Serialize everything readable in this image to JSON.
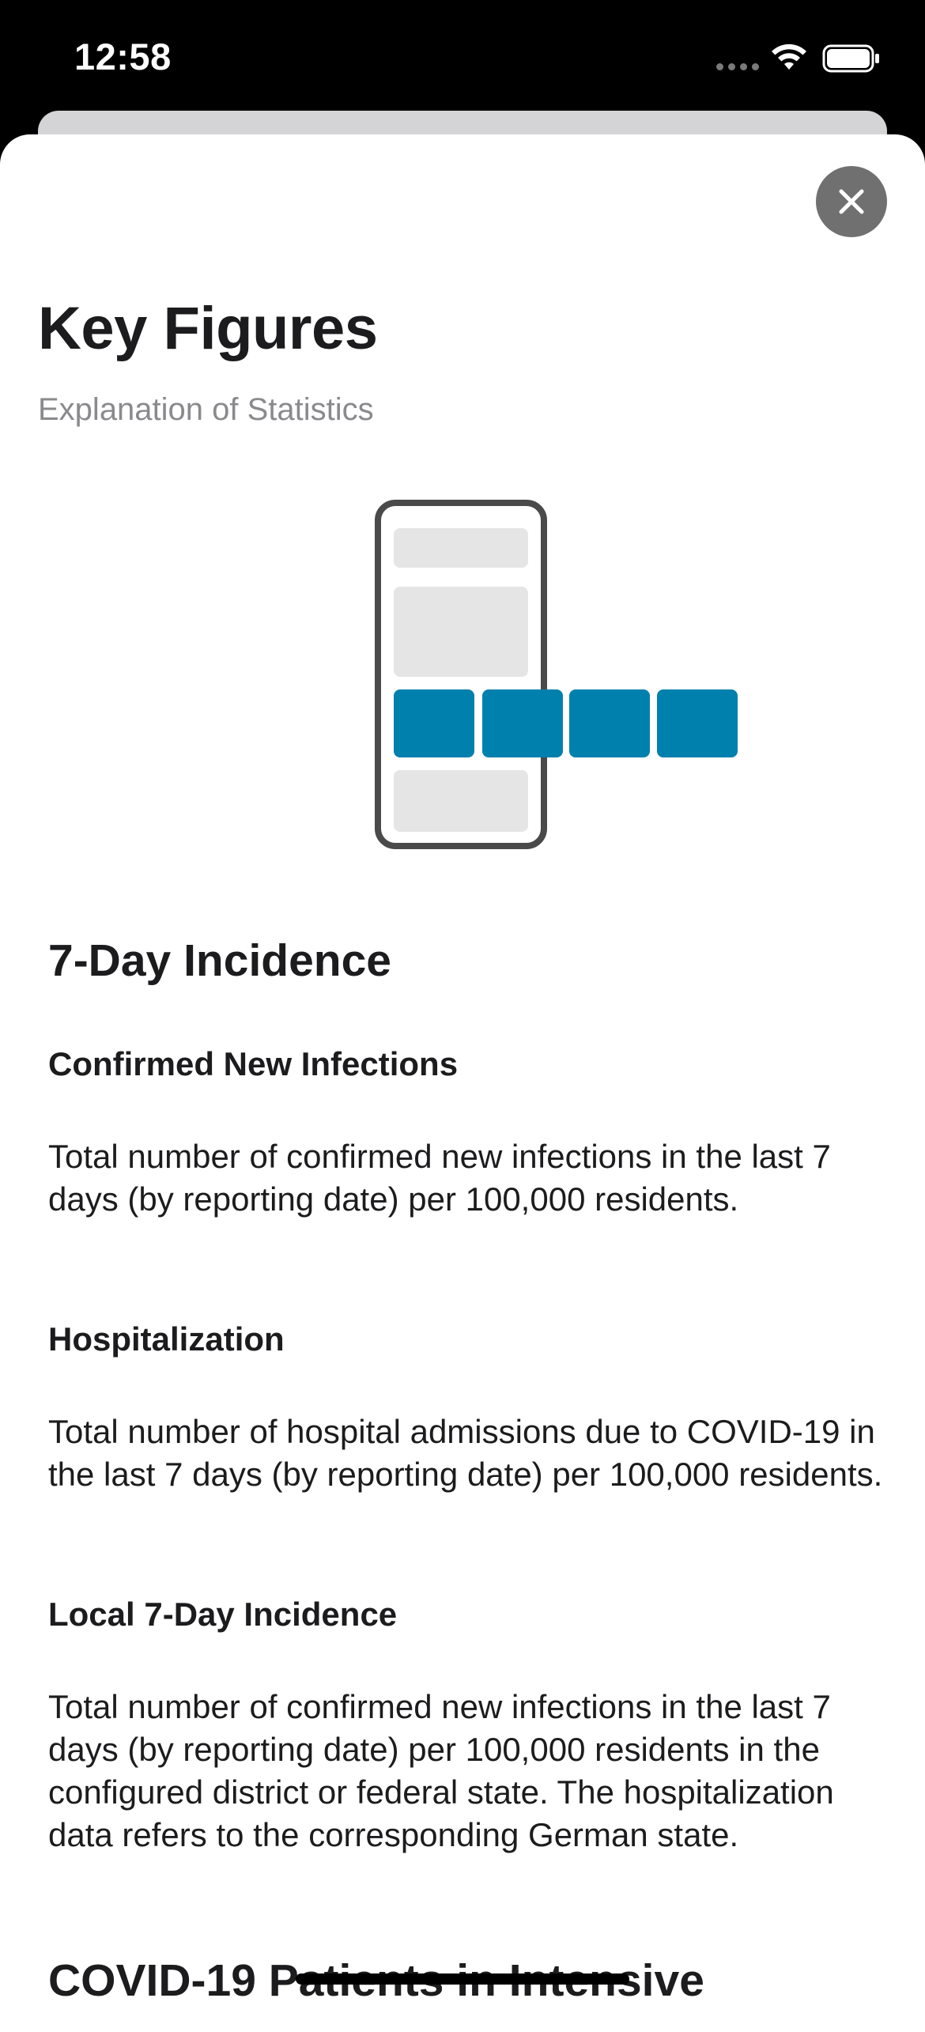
{
  "status_bar": {
    "time": "12:58",
    "icons": [
      "signal-icon",
      "wifi-icon",
      "battery-icon"
    ]
  },
  "header": {
    "title": "Key Figures",
    "subtitle": "Explanation of Statistics",
    "close_icon": "close-icon"
  },
  "illustration": {
    "icon": "phone-with-tiles-illustration",
    "colors": {
      "frame": "#4a4a4a",
      "placeholder": "#e5e5e5",
      "tile": "#0080ad"
    }
  },
  "sections": {
    "incidence": {
      "heading": "7-Day Incidence",
      "items": [
        {
          "title": "Confirmed New Infections",
          "text": "Total number of confirmed new infections in the last 7 days (by reporting date) per 100,000 residents."
        },
        {
          "title": "Hospitalization",
          "text": "Total number of hospital admissions due to COVID-19 in the last 7 days (by reporting date) per 100,000 residents."
        },
        {
          "title": "Local 7-Day Incidence",
          "text": "Total number of confirmed new infections in the last 7 days (by reporting date) per 100,000 residents in the configured district or federal state. The hospitalization data refers to the corresponding German state."
        }
      ]
    },
    "icu": {
      "heading": "COVID-19 Patients in Intensive"
    }
  },
  "colors": {
    "background": "#ffffff",
    "status_bar": "#000000",
    "accent": "#0080ad",
    "subtitle": "#8a8a8e",
    "close_button": "#707070"
  }
}
